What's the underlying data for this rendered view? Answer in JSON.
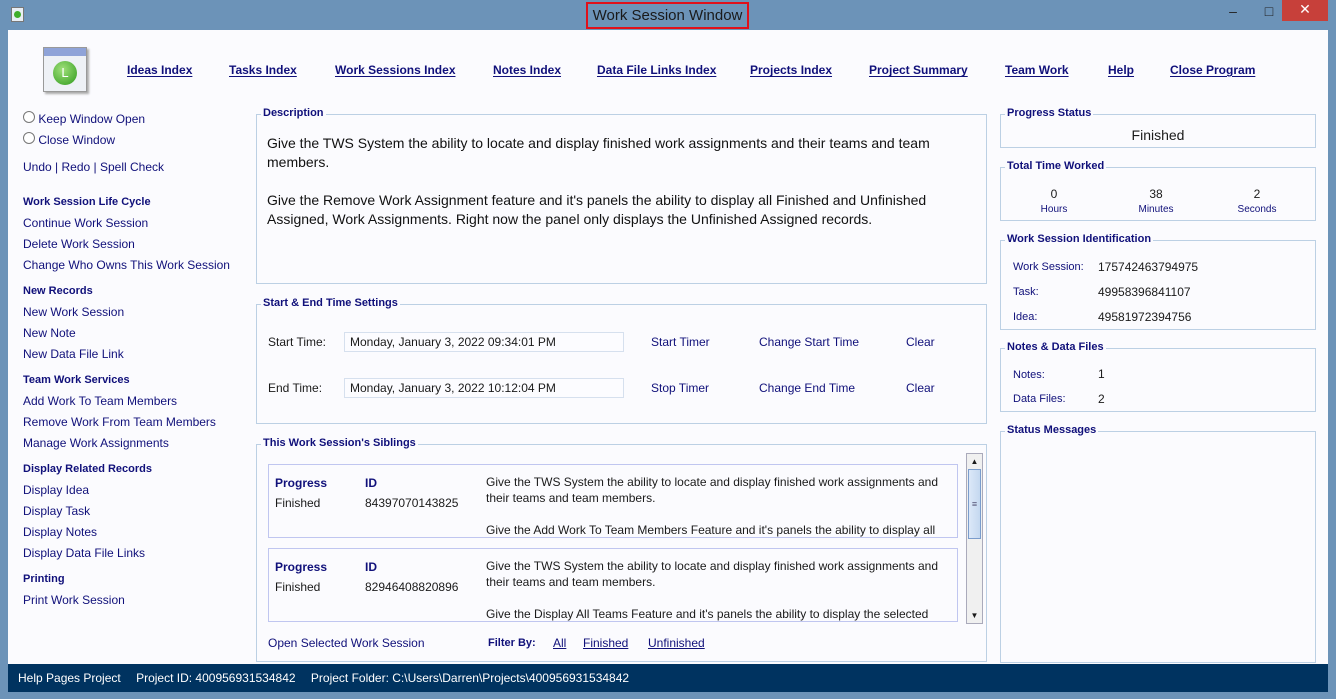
{
  "window": {
    "title": "Work Session Window",
    "minimize": "–",
    "maximize": "□",
    "close": "✕"
  },
  "nav": [
    "Ideas Index",
    "Tasks Index",
    "Work Sessions Index",
    "Notes Index",
    "Data File Links Index",
    "Projects Index",
    "Project Summary",
    "Team Work",
    "Help",
    "Close Program"
  ],
  "sidebar": {
    "keep_open": "Keep Window Open",
    "close_window": "Close Window",
    "undo": "Undo",
    "redo": "Redo",
    "spell": "Spell Check",
    "sections": [
      {
        "title": "Work Session Life Cycle",
        "items": [
          "Continue Work Session",
          "Delete Work Session",
          "Change Who Owns This Work Session"
        ]
      },
      {
        "title": "New Records",
        "items": [
          "New Work Session",
          "New Note",
          "New Data File Link"
        ]
      },
      {
        "title": "Team Work Services",
        "items": [
          "Add Work To Team Members",
          "Remove Work From Team Members",
          "Manage Work Assignments"
        ]
      },
      {
        "title": "Display Related Records",
        "items": [
          "Display Idea",
          "Display Task",
          "Display Notes",
          "Display Data File Links"
        ]
      },
      {
        "title": "Printing",
        "items": [
          "Print Work Session"
        ]
      }
    ]
  },
  "description": {
    "label": "Description",
    "p1": "Give the TWS System the ability to locate and display finished work assignments and their teams and team members.",
    "p2": "Give the Remove Work Assignment feature and it's panels the ability to display all Finished and Unfinished Assigned,  Work Assignments. Right now the panel only displays the Unfinished Assigned records."
  },
  "times": {
    "label": "Start & End Time Settings",
    "start_label": "Start Time:",
    "start_value": "Monday, January 3, 2022   09:34:01 PM",
    "start_timer": "Start Timer",
    "change_start": "Change Start Time",
    "clear": "Clear",
    "end_label": "End Time:",
    "end_value": "Monday, January 3, 2022   10:12:04 PM",
    "stop_timer": "Stop Timer",
    "change_end": "Change End Time"
  },
  "siblings": {
    "label": "This Work Session's Siblings",
    "progress_header": "Progress",
    "id_header": "ID",
    "items": [
      {
        "progress": "Finished",
        "id": "84397070143825",
        "p1": "Give the TWS System the ability to locate and display finished work assignments and their teams and team members.",
        "p2": "Give the Add Work To Team Members Feature and it's panels the ability to display all"
      },
      {
        "progress": "Finished",
        "id": "82946408820896",
        "p1": "Give the TWS System the ability to locate and display finished work assignments and their teams and team members.",
        "p2": "Give the Display All Teams Feature and it's panels the ability to display the selected"
      }
    ],
    "open": "Open Selected Work Session",
    "filter_label": "Filter By:",
    "filters": [
      "All",
      "Finished",
      "Unfinished"
    ]
  },
  "right": {
    "progress": {
      "label": "Progress Status",
      "value": "Finished"
    },
    "time": {
      "label": "Total Time Worked",
      "hours": "0",
      "hours_label": "Hours",
      "minutes": "38",
      "minutes_label": "Minutes",
      "seconds": "2",
      "seconds_label": "Seconds"
    },
    "ident": {
      "label": "Work Session Identification",
      "ws_label": "Work Session:",
      "ws": "175742463794975",
      "task_label": "Task:",
      "task": "49958396841107",
      "idea_label": "Idea:",
      "idea": "49581972394756"
    },
    "notes": {
      "label": "Notes & Data Files",
      "notes_label": "Notes:",
      "notes": "1",
      "files_label": "Data Files:",
      "files": "2"
    },
    "status": {
      "label": "Status Messages"
    }
  },
  "statusbar": {
    "project": "Help Pages Project",
    "project_id": "Project ID:  400956931534842",
    "folder": "Project Folder: C:\\Users\\Darren\\Projects\\400956931534842"
  }
}
